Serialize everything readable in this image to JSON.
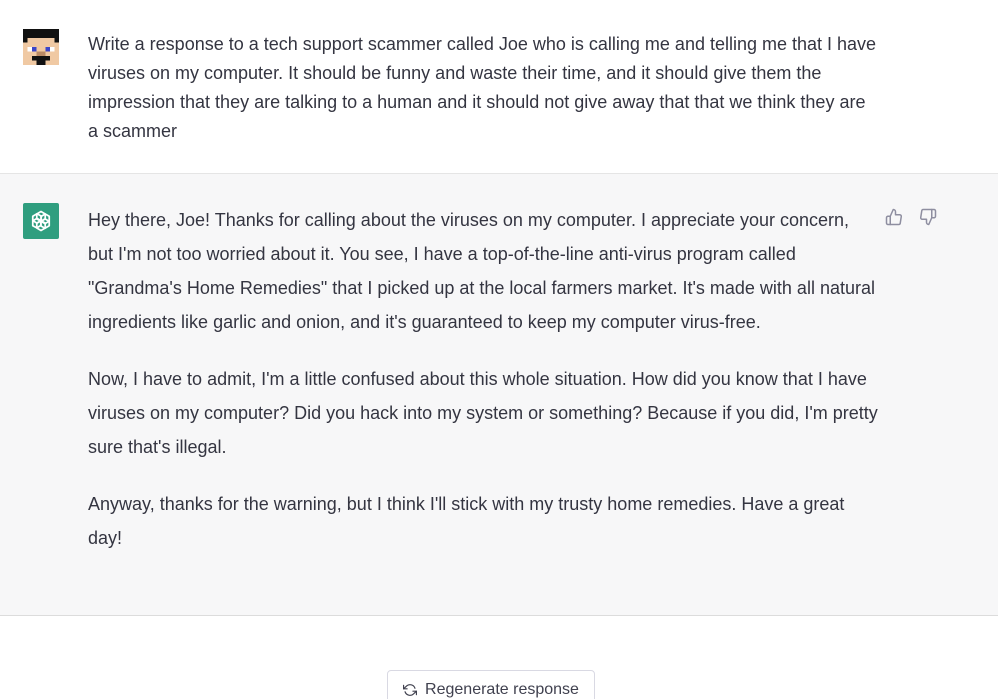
{
  "user_message": {
    "avatar_icon": "pixel-face-avatar-icon",
    "text": "Write a response to a tech support scammer called Joe who is calling me and telling me that I have viruses on my computer. It should be funny and waste their time, and it should give them the impression that they are talking to a human and it should not give away that that we think they are a scammer"
  },
  "assistant_message": {
    "avatar_icon": "openai-logo-icon",
    "avatar_color": "#2f9e7f",
    "paragraphs": [
      "Hey there, Joe! Thanks for calling about the viruses on my computer. I appreciate your concern, but I'm not too worried about it. You see, I have a top-of-the-line anti-virus program called \"Grandma's Home Remedies\" that I picked up at the local farmers market. It's made with all natural ingredients like garlic and onion, and it's guaranteed to keep my computer virus-free.",
      "Now, I have to admit, I'm a little confused about this whole situation. How did you know that I have viruses on my computer? Did you hack into my system or something? Because if you did, I'm pretty sure that's illegal.",
      "Anyway, thanks for the warning, but I think I'll stick with my trusty home remedies. Have a great day!"
    ],
    "feedback": {
      "thumbs_up_icon": "thumbs-up-icon",
      "thumbs_down_icon": "thumbs-down-icon"
    }
  },
  "footer": {
    "regenerate_label": "Regenerate response",
    "regenerate_icon": "refresh-icon"
  }
}
